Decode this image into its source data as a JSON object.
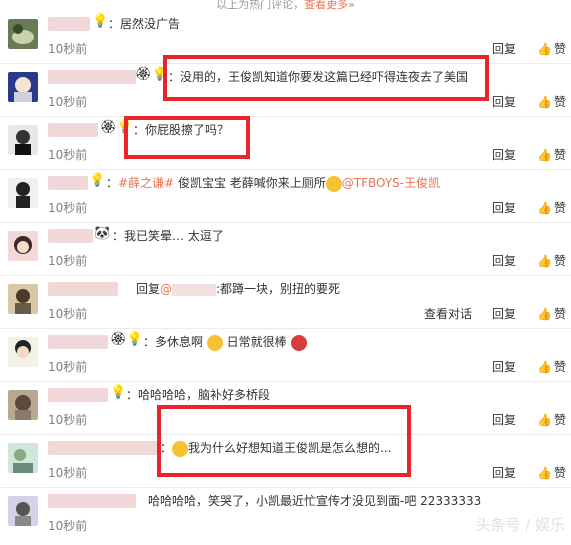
{
  "header": {
    "text": "以上为热门评论，",
    "more": "查看更多»"
  },
  "actions": {
    "reply": "回复",
    "like": "赞",
    "view_conversation": "查看对话"
  },
  "comments": [
    {
      "time": "10秒前",
      "text": "：居然没广告"
    },
    {
      "time": "10秒前",
      "text": "：没用的，王俊凯知道你要发这篇已经吓得连夜去了美国"
    },
    {
      "time": "10秒前",
      "text": "：你屁股擦了吗？"
    },
    {
      "time": "10秒前",
      "hashtag": "#薛之谦#",
      "text": " 俊凯宝宝 老薛喊你来上厕所",
      "mention": "@TFBOYS-王俊凯"
    },
    {
      "time": "10秒前",
      "text": "：我已笑晕… 太逗了"
    },
    {
      "time": "10秒前",
      "text_a": "回复",
      "mention": "@",
      "text": ":都蹲一块，别扭的要死"
    },
    {
      "time": "10秒前",
      "text": "：多休息啊",
      "text2": "日常就很棒"
    },
    {
      "time": "10秒前",
      "text": "：哈哈哈哈，脑补好多桥段"
    },
    {
      "time": "10秒前",
      "text": "我为什么好想知道王俊凯是怎么想的..."
    },
    {
      "time": "10秒前",
      "text": "哈哈哈哈，笑哭了，小凯最近忙宣传才没见到面-吧 22333333"
    }
  ],
  "watermark": "头条号 / 娱乐"
}
